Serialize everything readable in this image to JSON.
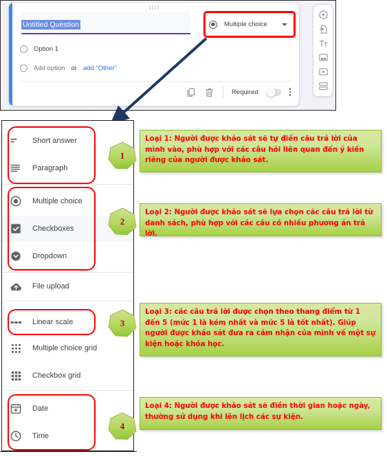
{
  "forms_card": {
    "question_title": "Untitled Question",
    "options": [
      {
        "label": "Option 1",
        "type": "radio"
      }
    ],
    "add_option_label": "Add option",
    "or_label": "or",
    "add_other_label": "add \"Other\"",
    "question_type_selected": "Multiple choice",
    "footer": {
      "duplicate_icon": "duplicate-icon",
      "delete_icon": "trash-icon",
      "required_label": "Required",
      "required_toggle_state": "off",
      "more_icon": "kebab-menu-icon"
    },
    "side_toolbar": [
      {
        "icon": "add-question-icon",
        "name": "add-question"
      },
      {
        "icon": "import-questions-icon",
        "name": "import-questions"
      },
      {
        "icon": "add-title-icon",
        "name": "add-title-and-description"
      },
      {
        "icon": "add-image-icon",
        "name": "add-image"
      },
      {
        "icon": "add-video-icon",
        "name": "add-video"
      },
      {
        "icon": "add-section-icon",
        "name": "add-section"
      }
    ]
  },
  "menu": {
    "groups": [
      {
        "badge": "1",
        "items": [
          {
            "label": "Short answer",
            "icon": "short-answer-icon"
          },
          {
            "label": "Paragraph",
            "icon": "paragraph-icon"
          }
        ]
      },
      {
        "badge": "2",
        "items": [
          {
            "label": "Multiple choice",
            "icon": "radio-button-icon"
          },
          {
            "label": "Checkboxes",
            "icon": "checkbox-icon"
          },
          {
            "label": "Dropdown",
            "icon": "dropdown-icon"
          }
        ]
      },
      {
        "badge": null,
        "items": [
          {
            "label": "File upload",
            "icon": "cloud-upload-icon"
          }
        ]
      },
      {
        "badge": "3",
        "items": [
          {
            "label": "Linear scale",
            "icon": "linear-scale-icon"
          }
        ]
      },
      {
        "badge": null,
        "items": [
          {
            "label": "Multiple choice grid",
            "icon": "radio-grid-icon"
          },
          {
            "label": "Checkbox grid",
            "icon": "checkbox-grid-icon"
          }
        ]
      },
      {
        "badge": "4",
        "items": [
          {
            "label": "Date",
            "icon": "calendar-icon"
          },
          {
            "label": "Time",
            "icon": "clock-icon"
          }
        ]
      }
    ],
    "flat_items": [
      {
        "label": "Short answer"
      },
      {
        "label": "Paragraph"
      },
      {
        "label": "Multiple choice"
      },
      {
        "label": "Checkboxes"
      },
      {
        "label": "Dropdown"
      },
      {
        "label": "File upload"
      },
      {
        "label": "Linear scale"
      },
      {
        "label": "Multiple choice grid"
      },
      {
        "label": "Checkbox grid"
      },
      {
        "label": "Date"
      },
      {
        "label": "Time"
      }
    ]
  },
  "callouts": [
    {
      "id": "loai-1",
      "text": "Loại 1: Người được khảo sát sẽ tự điền câu trả lời của mình vào, phù hợp với các câu hỏi liên quan đến ý kiến riêng của người được khảo sát."
    },
    {
      "id": "loai-2",
      "text": "Loại 2: Người được khảo sát sẽ lựa chọn các câu trả lời từ danh sách, phù hợp với các câu có nhiều phương án trả lời."
    },
    {
      "id": "loai-3",
      "text": "Loại 3: các câu trả lời được chọn theo thang điểm từ 1 đến 5 (mức 1 là kém nhất và mức 5 là tốt nhất). Giúp người được khảo sát đưa ra cảm nhận của mình về một sự kiện hoặc khóa học."
    },
    {
      "id": "loai-4",
      "text": "Loại 4: Người được khảo sát sẽ điền thời gian hoặc ngày, thường sử dụng khi lên lịch các sự kiện."
    }
  ],
  "badges": [
    {
      "number": "1"
    },
    {
      "number": "2"
    },
    {
      "number": "3"
    },
    {
      "number": "4"
    }
  ],
  "colors": {
    "highlight_red": "#ff0000",
    "arrow_navy": "#1f3864",
    "callout_green": "#a8d046",
    "callout_text_red": "#ff0000",
    "forms_accent_blue": "#4285f4",
    "forms_underline_purple": "#673ab7",
    "badge_green": "#a9d14c"
  }
}
